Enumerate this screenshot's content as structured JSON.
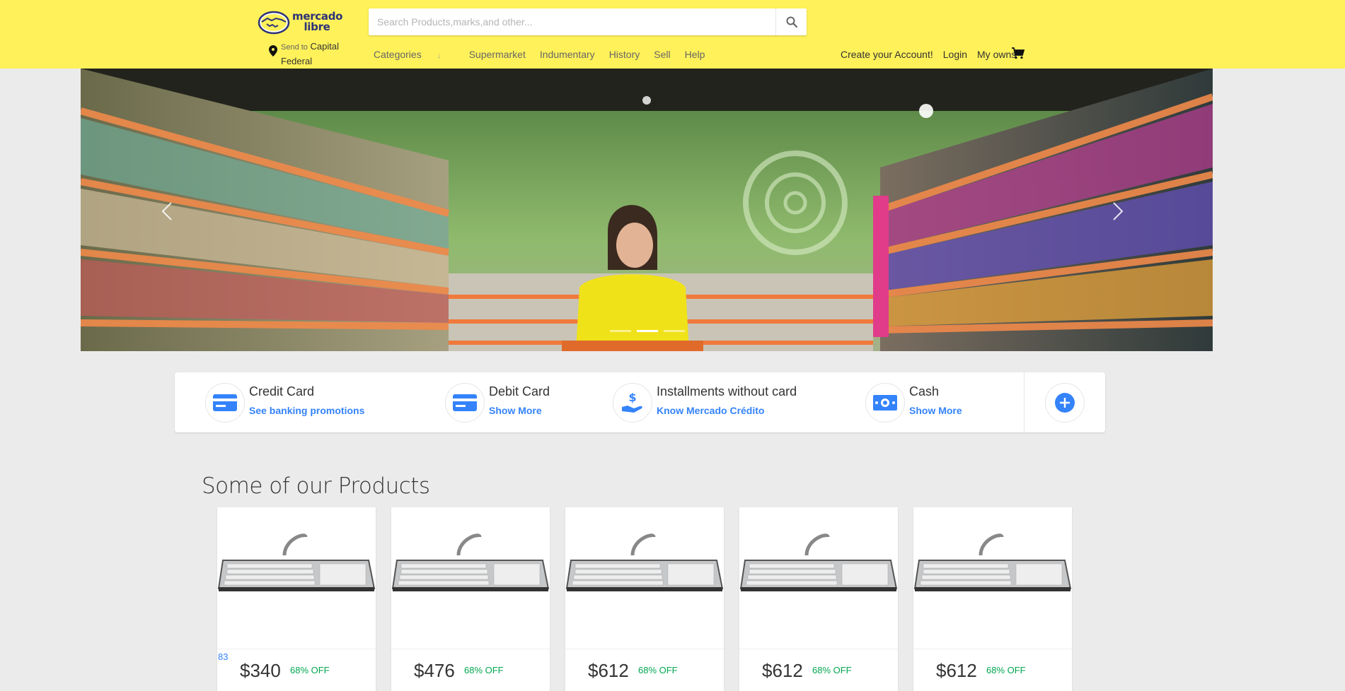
{
  "header": {
    "logo_text_line1": "mercado",
    "logo_text_line2": "libre",
    "send_to_label": "Send to",
    "send_to_city": "Capital Federal",
    "search_placeholder": "Search Products,marks,and other...",
    "nav": [
      {
        "label": "Categories",
        "arrow": "↓"
      },
      {
        "label": "Supermarket"
      },
      {
        "label": "Indumentary"
      },
      {
        "label": "History"
      },
      {
        "label": "Sell"
      },
      {
        "label": "Help"
      }
    ],
    "user_nav": [
      "Create your Account!",
      "Login",
      "My owns"
    ]
  },
  "hero": {
    "slides_count": 3,
    "active_slide": 2
  },
  "payments": [
    {
      "title": "Credit Card",
      "link": "See banking promotions",
      "icon": "credit-card-icon"
    },
    {
      "title": "Debit Card",
      "link": "Show More",
      "icon": "debit-card-icon"
    },
    {
      "title": "Installments without card",
      "link": "Know Mercado Crédito",
      "icon": "hand-money-icon"
    },
    {
      "title": "Cash",
      "link": "Show More",
      "icon": "cash-icon"
    }
  ],
  "products_section": {
    "title": "Some of our Products",
    "items": [
      {
        "tag": "83",
        "price": "$340",
        "discount": "68% OFF",
        "image": "keyboard-image"
      },
      {
        "tag": "",
        "price": "$476",
        "discount": "68% OFF",
        "image": "keyboard-image"
      },
      {
        "tag": "",
        "price": "$612",
        "discount": "68% OFF",
        "image": "keyboard-image"
      },
      {
        "tag": "",
        "price": "$612",
        "discount": "68% OFF",
        "image": "keyboard-image"
      },
      {
        "tag": "",
        "price": "$612",
        "discount": "68% OFF",
        "image": "keyboard-image"
      }
    ]
  },
  "colors": {
    "header_bg": "#fff159",
    "accent_blue": "#3483fa",
    "discount_green": "#00a650",
    "page_bg": "#ebebeb"
  }
}
